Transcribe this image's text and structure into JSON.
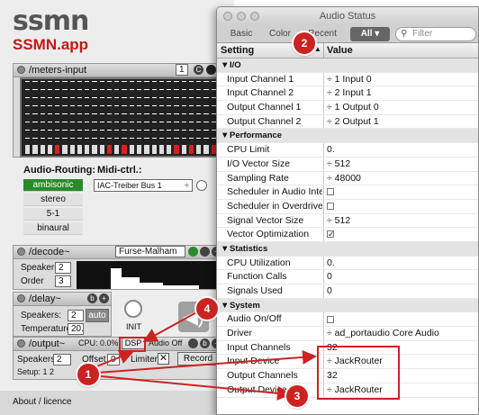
{
  "logo": {
    "top": "ssmn",
    "bottom": "SSMN.app"
  },
  "meters": {
    "title": "/meters-input",
    "channel": "1",
    "icon_c": "C",
    "meter_count": 26,
    "red_meters": [
      4,
      11,
      13,
      20,
      22,
      25
    ]
  },
  "routing": {
    "label": "Audio-Routing:",
    "options": [
      "ambisonic",
      "stereo",
      "5-1",
      "binaural"
    ],
    "selected": 0
  },
  "midi": {
    "label": "Midi-ctrl.:",
    "device": "IAC-Treiber Bus 1"
  },
  "decode": {
    "title": "/decode~",
    "preset": "Furse-Malham",
    "speakers_label": "Speakers",
    "speakers": "2",
    "order_label": "Order",
    "order": "3"
  },
  "delay": {
    "title": "/delay~",
    "speakers_label": "Speakers:",
    "speakers": "2",
    "auto": "auto",
    "temp_label": "Temperature:",
    "temp": "20.",
    "init": "INIT"
  },
  "output": {
    "title": "/output~",
    "cpu": "CPU: 0.0%",
    "dsp": "DSP",
    "audio_off": "Audio Off",
    "speakers_label": "Speakers",
    "speakers": "2",
    "offset_label": "Offset",
    "offset": "0",
    "limiter": "Limiter",
    "record": "Record",
    "setup": "Setup: 1 2"
  },
  "about": "About / licence",
  "window": {
    "title": "Audio Status",
    "tabs": [
      "Basic",
      "Color",
      "Recent",
      "All"
    ],
    "filter_placeholder": "Filter",
    "col_setting": "Setting",
    "col_value": "Value",
    "rows": [
      {
        "sec": true,
        "k": "I/O"
      },
      {
        "k": "Input Channel 1",
        "v": "÷ 1 Input 0"
      },
      {
        "k": "Input Channel 2",
        "v": "÷ 2 Input 1"
      },
      {
        "k": "Output Channel 1",
        "v": "÷ 1 Output 0"
      },
      {
        "k": "Output Channel 2",
        "v": "÷ 2 Output 1"
      },
      {
        "sec": true,
        "k": "Performance"
      },
      {
        "k": "CPU Limit",
        "v": "0."
      },
      {
        "k": "I/O Vector Size",
        "v": "÷ 512"
      },
      {
        "k": "Sampling Rate",
        "v": "÷ 48000"
      },
      {
        "k": "Scheduler in Audio Interrupt",
        "chk": false
      },
      {
        "k": "Scheduler in Overdrive",
        "chk": false
      },
      {
        "k": "Signal Vector Size",
        "v": "÷ 512"
      },
      {
        "k": "Vector Optimization",
        "chk": true
      },
      {
        "sec": true,
        "k": "Statistics"
      },
      {
        "k": "CPU Utilization",
        "v": "0."
      },
      {
        "k": "Function Calls",
        "v": "0"
      },
      {
        "k": "Signals Used",
        "v": "0"
      },
      {
        "sec": true,
        "k": "System"
      },
      {
        "k": "Audio On/Off",
        "chk": false
      },
      {
        "k": "Driver",
        "v": "÷ ad_portaudio Core Audio"
      },
      {
        "k": "Input Channels",
        "v": "32"
      },
      {
        "k": "Input Device",
        "v": "÷ JackRouter"
      },
      {
        "k": "Output Channels",
        "v": "32"
      },
      {
        "k": "Output Device",
        "v": "÷ JackRouter"
      }
    ]
  },
  "badges": [
    "1",
    "2",
    "3",
    "4"
  ],
  "colors": {
    "annotation": "#cc2222",
    "routing_selected": "#2a8a2a",
    "meter_red": "#d82020"
  }
}
